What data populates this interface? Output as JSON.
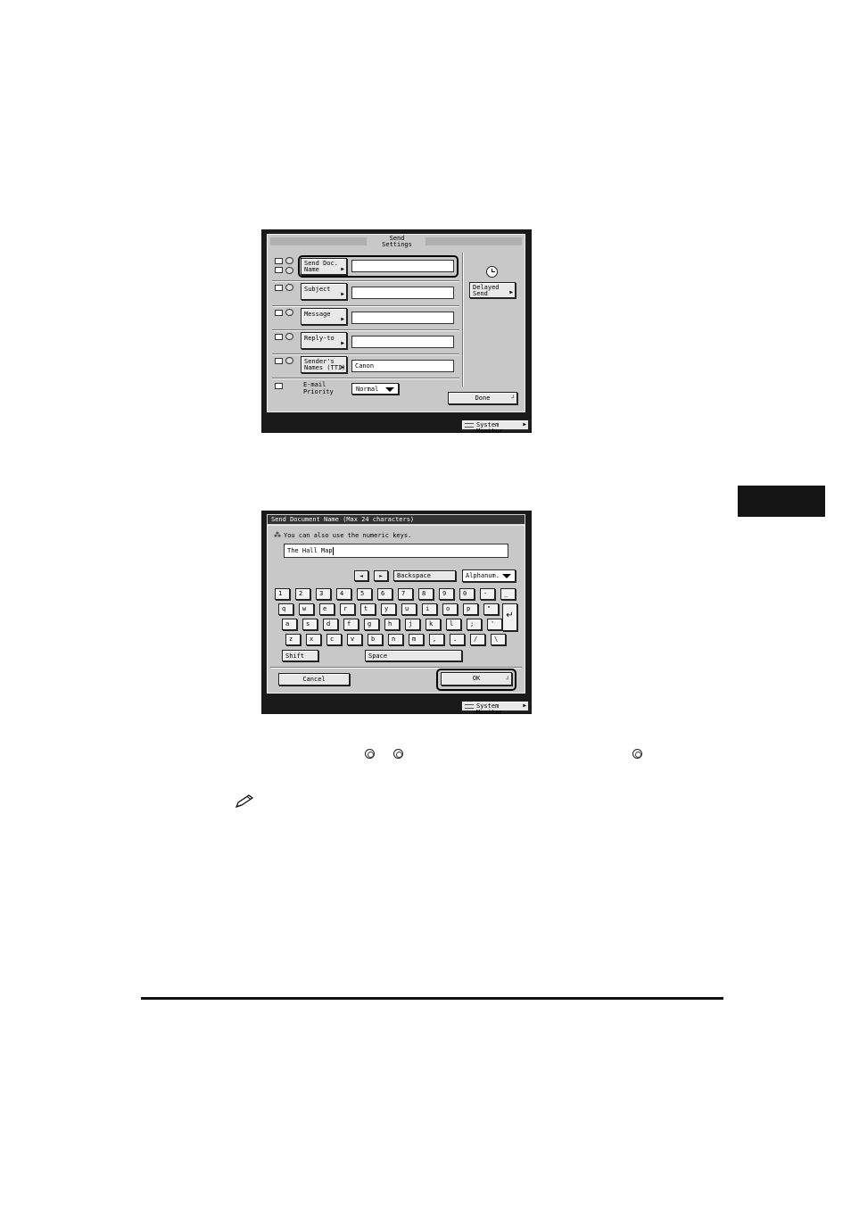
{
  "send_settings": {
    "title_line1": "Send",
    "title_line2": "Settings",
    "rows": [
      {
        "label_line1": "Send Doc.",
        "label_line2": "Name",
        "value": ""
      },
      {
        "label_line1": "Subject",
        "label_line2": "",
        "value": ""
      },
      {
        "label_line1": "Message",
        "label_line2": "",
        "value": ""
      },
      {
        "label_line1": "Reply-to",
        "label_line2": "",
        "value": ""
      },
      {
        "label_line1": "Sender's",
        "label_line2": "Names (TTI)",
        "value": "Canon"
      }
    ],
    "priority_label_line1": "E-mail",
    "priority_label_line2": "Priority",
    "priority_value": "Normal",
    "delayed_line1": "Delayed",
    "delayed_line2": "Send",
    "done_label": "Done",
    "system_monitor": "System Monitor"
  },
  "keyboard_screen": {
    "title": "Send Document Name (Max 24 characters)",
    "hint": "You can also use the numeric keys.",
    "input_value": "The Hall Map",
    "backspace_label": "Backspace",
    "mode_value": "Alphanum.",
    "left_arrow": "◄",
    "right_arrow": "►",
    "row1": [
      "1",
      "2",
      "3",
      "4",
      "5",
      "6",
      "7",
      "8",
      "9",
      "0",
      "-",
      "_"
    ],
    "row2": [
      "q",
      "w",
      "e",
      "r",
      "t",
      "y",
      "u",
      "i",
      "o",
      "p",
      "\""
    ],
    "row3": [
      "a",
      "s",
      "d",
      "f",
      "g",
      "h",
      "j",
      "k",
      "l",
      ";",
      "'"
    ],
    "row4": [
      "z",
      "x",
      "c",
      "v",
      "b",
      "n",
      "m",
      ",",
      ".",
      "/",
      "\\"
    ],
    "enter_symbol": "↵",
    "shift_label": "Shift",
    "space_label": "Space",
    "cancel_label": "Cancel",
    "ok_label": "OK",
    "system_monitor": "System Monitor"
  }
}
